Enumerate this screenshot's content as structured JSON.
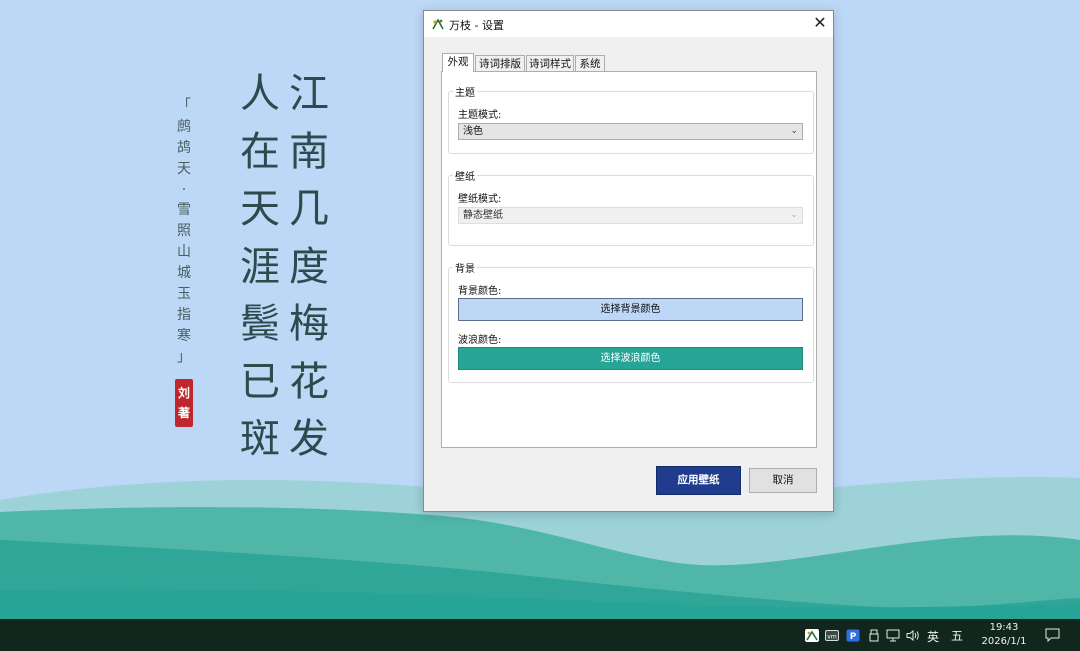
{
  "desktop": {
    "poem_right_column": [
      "江",
      "南",
      "几",
      "度",
      "梅",
      "花",
      "发"
    ],
    "poem_left_column": [
      "人",
      "在",
      "天",
      "涯",
      "鬓",
      "已",
      "斑"
    ],
    "poem_title": [
      "「",
      "鹧",
      "鸪",
      "天",
      "·",
      "雪",
      "照",
      "山",
      "城",
      "玉",
      "指",
      "寒",
      "」"
    ],
    "seal_chars": [
      "刘",
      "著"
    ],
    "poem_color": "#2f4a4c",
    "seal_color": "#c0272d"
  },
  "window": {
    "title": "万枝 - 设置",
    "close_label": "✕",
    "tabs": [
      {
        "label": "外观"
      },
      {
        "label": "诗词排版"
      },
      {
        "label": "诗词样式"
      },
      {
        "label": "系统"
      }
    ],
    "theme_group": {
      "title": "主题",
      "mode_label": "主题模式:",
      "mode_value": "浅色"
    },
    "wallpaper_group": {
      "title": "壁纸",
      "mode_label": "壁纸模式:",
      "mode_value": "静态壁纸"
    },
    "background_group": {
      "title": "背景",
      "bg_color_label": "背景颜色:",
      "bg_color_button": "选择背景颜色",
      "bg_color_value": "#bcd8f6",
      "wave_color_label": "波浪颜色:",
      "wave_color_button": "选择波浪颜色",
      "wave_color_value": "#26a596"
    },
    "apply_button": "应用壁纸",
    "cancel_button": "取消",
    "accent": "#1f3d8c"
  },
  "taskbar": {
    "ime_lang": "英",
    "ime_mode": "五",
    "time": "19:43",
    "date": "2026/1/1",
    "tray_icons": [
      "wanzhi-app-icon",
      "vm-icon",
      "p-app-icon",
      "usb-icon",
      "network-icon",
      "volume-icon"
    ]
  }
}
